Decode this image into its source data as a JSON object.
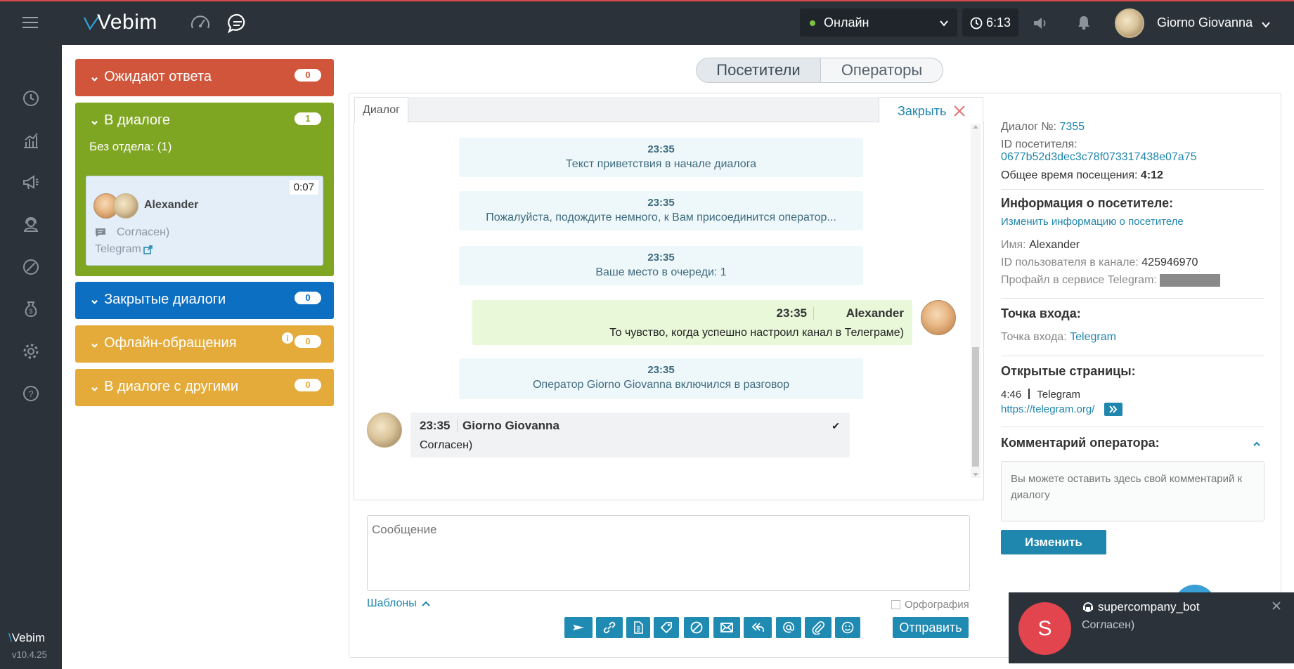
{
  "app": {
    "name": "Vebim",
    "version": "v10.4.25"
  },
  "header": {
    "status": "Онлайн",
    "timer": "6:13",
    "user_name": "Giorno Giovanna"
  },
  "icons": {
    "menu": "hamburger-icon",
    "dashboard": "speedometer-icon",
    "chat": "chat-bubble-icon",
    "clock": "clock-icon",
    "volume": "speaker-icon",
    "bell": "bell-icon"
  },
  "sidebar": {
    "nav_icons": [
      "history-icon",
      "statistics-icon",
      "megaphone-icon",
      "operators-icon",
      "ban-icon",
      "money-icon",
      "settings-icon",
      "help-icon"
    ]
  },
  "queues": {
    "waiting": {
      "label": "Ожидают ответа",
      "count": "0"
    },
    "in_dialog": {
      "label": "В диалоге",
      "count": "1",
      "department": "Без отдела: (1)"
    },
    "closed": {
      "label": "Закрытые диалоги",
      "count": "0"
    },
    "offline": {
      "label": "Офлайн-обращения",
      "count": "0"
    },
    "others": {
      "label": "В диалоге с другими",
      "count": "0"
    }
  },
  "visitor_card": {
    "name": "Alexander",
    "timer": "0:07",
    "last_message": "Согласен)",
    "channel": "Telegram"
  },
  "tabs": {
    "visitors": "Посетители",
    "operators": "Операторы"
  },
  "dialog_tab": {
    "label": "Диалог",
    "close_label": "Закрыть"
  },
  "messages": {
    "sys1": {
      "time": "23:35",
      "text": "Текст приветствия в начале диалога"
    },
    "sys2": {
      "time": "23:35",
      "text": "Пожалуйста, подождите немного, к Вам присоединится оператор..."
    },
    "sys3": {
      "time": "23:35",
      "text": "Ваше место в очереди: 1"
    },
    "visitor": {
      "time": "23:35",
      "author": "Alexander",
      "text": "То чувство, когда успешно настроил канал в Телеграме)"
    },
    "sys4": {
      "time": "23:35",
      "text": "Оператор Giorno Giovanna включился в разговор"
    },
    "operator": {
      "time": "23:35",
      "author": "Giorno Giovanna",
      "text": "Согласен)",
      "check": "✔"
    }
  },
  "composer": {
    "placeholder": "Сообщение",
    "templates": "Шаблоны",
    "spellcheck": "Орфография",
    "send": "Отправить",
    "tool_icons": [
      "send-arrow-icon",
      "link-icon",
      "document-icon",
      "tag-icon",
      "ban-icon",
      "envelope-icon",
      "reply-all-icon",
      "mention-icon",
      "attach-icon",
      "smile-icon"
    ]
  },
  "info": {
    "dialog_label": "Диалог №:",
    "dialog_no": "7355",
    "visitor_id_label": "ID посетителя:",
    "visitor_id": "0677b52d3dec3c78f073317438e07a75",
    "total_time_label": "Общее время посещения:",
    "total_time": "4:12",
    "visitor_info_title": "Информация о посетителе:",
    "edit_info": "Изменить информацию о посетителе",
    "name_label": "Имя:",
    "name": "Alexander",
    "channel_id_label": "ID пользователя в канале:",
    "channel_id": "425946970",
    "profile_label": "Профайл в сервисе Telegram:",
    "entry_title": "Точка входа:",
    "entry_label": "Точка входа:",
    "entry_value": "Telegram",
    "pages_title": "Открытые страницы:",
    "page_time": "4:46",
    "page_name": "Telegram",
    "page_url": "https://telegram.org/",
    "comment_title": "Комментарий оператора:",
    "comment_placeholder": "Вы можете оставить здесь свой комментарий к диалогу",
    "edit_button": "Изменить"
  },
  "toast": {
    "letter": "S",
    "bot": "supercompany_bot",
    "text": "Согласен)"
  }
}
